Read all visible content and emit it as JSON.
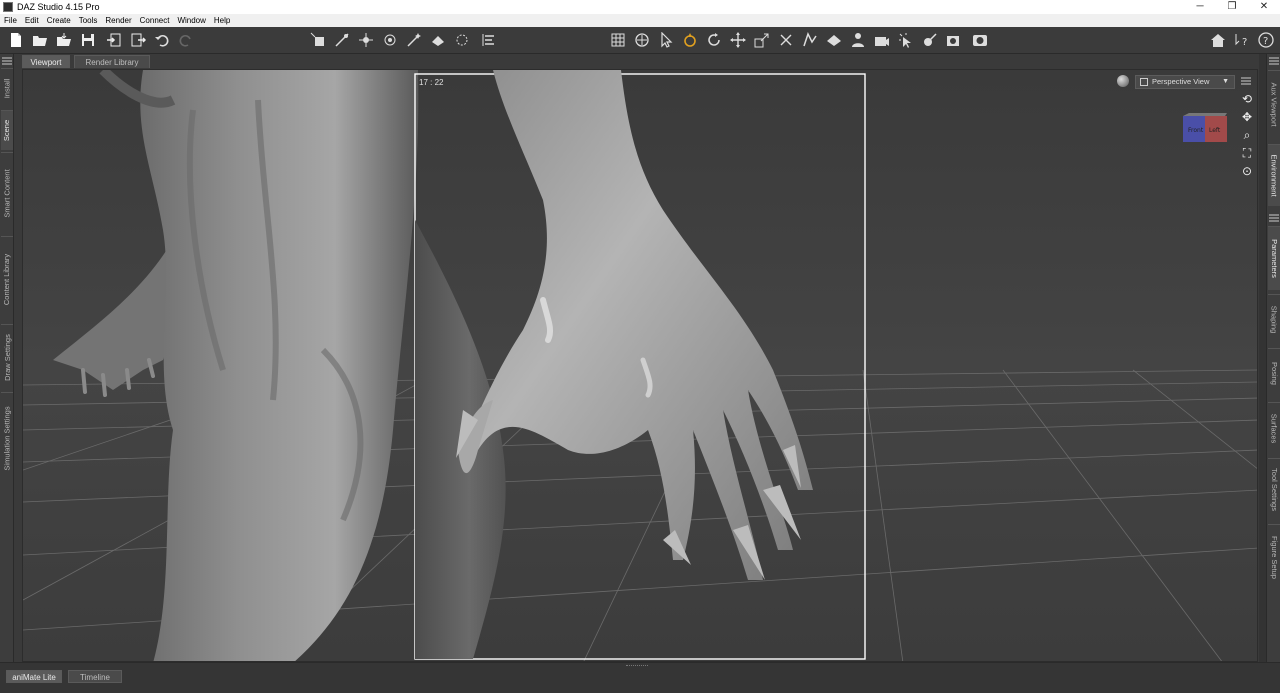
{
  "window": {
    "title": "DAZ Studio 4.15 Pro",
    "minimize": "─",
    "maximize": "❐",
    "close": "✕"
  },
  "menu": [
    "File",
    "Edit",
    "Create",
    "Tools",
    "Render",
    "Connect",
    "Window",
    "Help"
  ],
  "tabs": {
    "viewport": "Viewport",
    "render_library": "Render Library"
  },
  "left_panes": [
    "Install",
    "Scene",
    "Smart Content",
    "Content Library",
    "Draw Settings",
    "Simulation Settings"
  ],
  "right_panes": [
    "Aux Viewport",
    "Environment",
    "Parameters",
    "Shaping",
    "Posing",
    "Surfaces",
    "Tool Settings",
    "Figure Setup"
  ],
  "viewport": {
    "frame_label": "17 : 22",
    "camera": "Perspective View",
    "cube_faces": [
      "Front",
      "Left"
    ]
  },
  "bottom_tabs": {
    "animate": "aniMate Lite",
    "timeline": "Timeline"
  },
  "colors": {
    "viewport_bg": "#3f3f3f",
    "chrome": "#3b3b3b",
    "active_tool": "#e0a020",
    "cube_blue": "#4a4fa8",
    "cube_red": "#a24a4a"
  }
}
